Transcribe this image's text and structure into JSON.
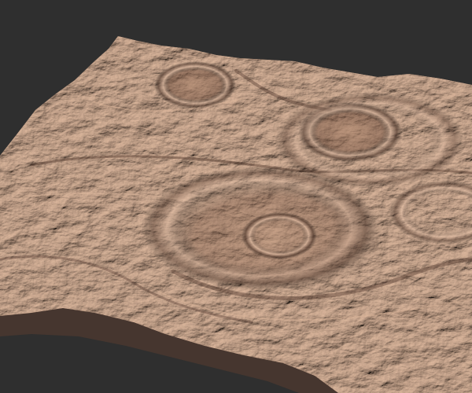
{
  "scene": {
    "background_color": "#2f2f2f",
    "terrain_base_color": "#a9826a",
    "terrain_light_color": "#cfa78e",
    "terrain_shadow_color": "#5a3d30",
    "features": [
      "terrain-heightmap",
      "crater-top-left",
      "crater-top-right",
      "crater-center",
      "crater-right-edge"
    ]
  }
}
